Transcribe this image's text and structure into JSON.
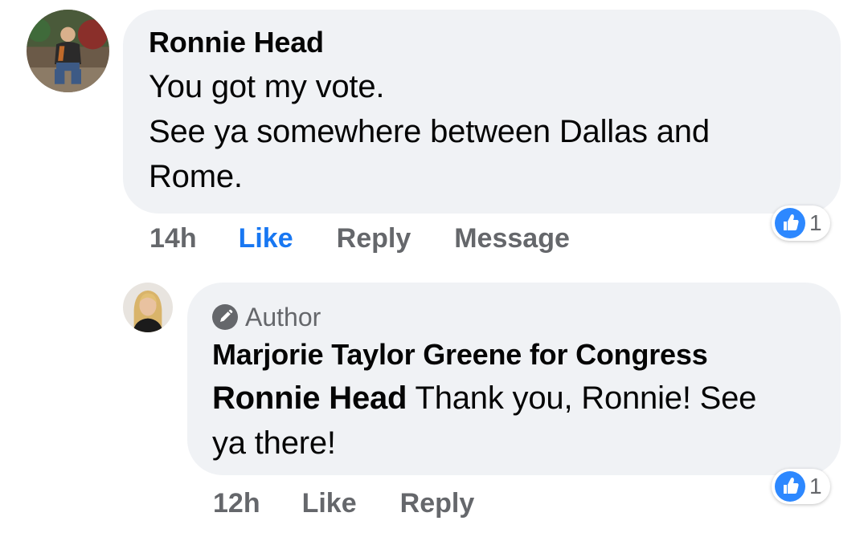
{
  "comment": {
    "author": "Ronnie Head",
    "lines": [
      "You got my vote.",
      "See ya somewhere between Dallas and",
      "Rome."
    ],
    "timestamp": "14h",
    "actions": {
      "like": "Like",
      "reply": "Reply",
      "message": "Message"
    },
    "reaction_count": "1",
    "like_active_color": "#1877f2"
  },
  "reply": {
    "badge": "Author",
    "author": "Marjorie Taylor Greene for Congress",
    "mention": "Ronnie Head",
    "text_line1": " Thank you, Ronnie! See",
    "text_line2": "ya there!",
    "timestamp": "12h",
    "actions": {
      "like": "Like",
      "reply": "Reply"
    },
    "reaction_count": "1"
  },
  "colors": {
    "bubble": "#f0f2f5",
    "secondary_text": "#65676b",
    "like_badge": "#2d88ff"
  },
  "icons": {
    "badge": "pencil-icon",
    "reaction": "thumbs-up-icon"
  }
}
